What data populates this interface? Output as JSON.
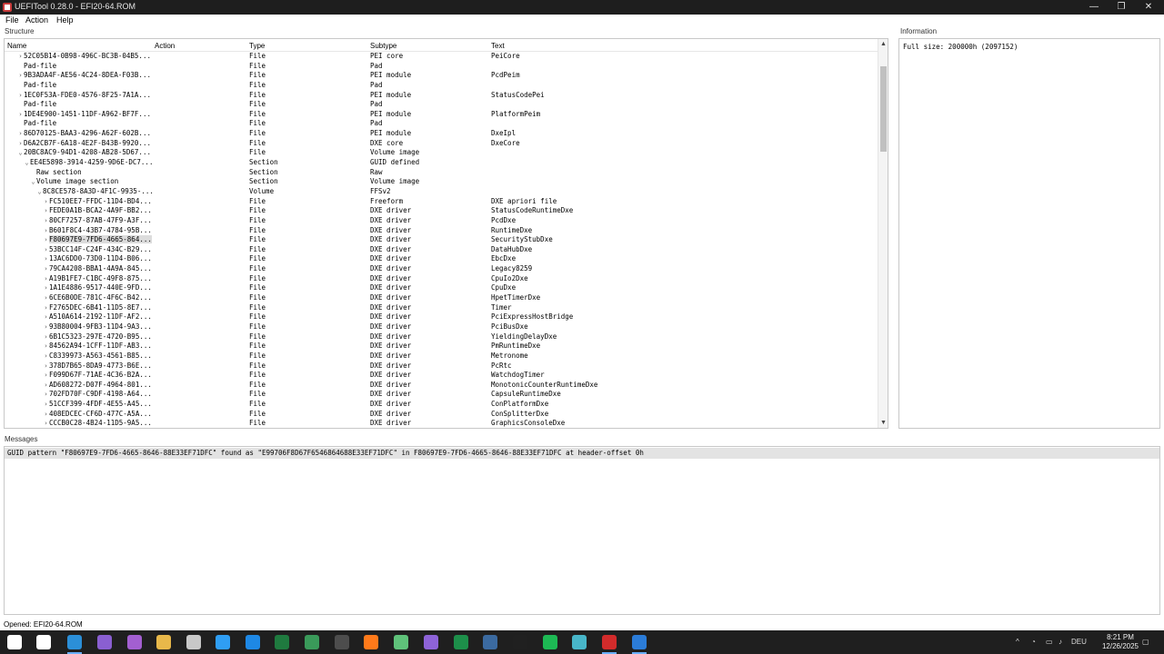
{
  "window": {
    "title": "UEFITool 0.28.0 - EFI20-64.ROM",
    "minimize": "—",
    "restore": "❐",
    "close": "✕"
  },
  "menu": {
    "file": "File",
    "action": "Action",
    "help": "Help"
  },
  "structure": {
    "label": "Structure",
    "columns": {
      "name": "Name",
      "action": "Action",
      "type": "Type",
      "subtype": "Subtype",
      "text": "Text"
    },
    "rows": [
      {
        "name": "52C05B14-0B98-496C-BC3B-04B5...",
        "type": "File",
        "subtype": "PEI core",
        "text": "PeiCore",
        "level": 1,
        "arrow": "›"
      },
      {
        "name": "Pad-file",
        "type": "File",
        "subtype": "Pad",
        "text": "",
        "level": 1,
        "arrow": ""
      },
      {
        "name": "9B3ADA4F-AE56-4C24-8DEA-F03B...",
        "type": "File",
        "subtype": "PEI module",
        "text": "PcdPeim",
        "level": 1,
        "arrow": "›"
      },
      {
        "name": "Pad-file",
        "type": "File",
        "subtype": "Pad",
        "text": "",
        "level": 1,
        "arrow": ""
      },
      {
        "name": "1EC0F53A-FDE0-4576-8F25-7A1A...",
        "type": "File",
        "subtype": "PEI module",
        "text": "StatusCodePei",
        "level": 1,
        "arrow": "›"
      },
      {
        "name": "Pad-file",
        "type": "File",
        "subtype": "Pad",
        "text": "",
        "level": 1,
        "arrow": ""
      },
      {
        "name": "1DE4E900-1451-11DF-A962-BF7F...",
        "type": "File",
        "subtype": "PEI module",
        "text": "PlatformPeim",
        "level": 1,
        "arrow": "›"
      },
      {
        "name": "Pad-file",
        "type": "File",
        "subtype": "Pad",
        "text": "",
        "level": 1,
        "arrow": ""
      },
      {
        "name": "86D70125-BAA3-4296-A62F-602B...",
        "type": "File",
        "subtype": "PEI module",
        "text": "DxeIpl",
        "level": 1,
        "arrow": "›"
      },
      {
        "name": "D6A2CB7F-6A18-4E2F-B43B-9920...",
        "type": "File",
        "subtype": "DXE core",
        "text": "DxeCore",
        "level": 1,
        "arrow": "›"
      },
      {
        "name": "20BC8AC9-94D1-4208-AB28-5D67...",
        "type": "File",
        "subtype": "Volume image",
        "text": "",
        "level": 1,
        "arrow": "⌄"
      },
      {
        "name": "EE4E5898-3914-4259-9D6E-DC7...",
        "type": "Section",
        "subtype": "GUID defined",
        "text": "",
        "level": 2,
        "arrow": "⌄"
      },
      {
        "name": "Raw section",
        "type": "Section",
        "subtype": "Raw",
        "text": "",
        "level": 3,
        "arrow": ""
      },
      {
        "name": "Volume image section",
        "type": "Section",
        "subtype": "Volume image",
        "text": "",
        "level": 3,
        "arrow": "⌄"
      },
      {
        "name": "8C8CE578-8A3D-4F1C-9935-...",
        "type": "Volume",
        "subtype": "FFSv2",
        "text": "",
        "level": 4,
        "arrow": "⌄"
      },
      {
        "name": "FC510EE7-FFDC-11D4-BD4...",
        "type": "File",
        "subtype": "Freeform",
        "text": "DXE apriori file",
        "level": 5,
        "arrow": "›"
      },
      {
        "name": "FEDE0A1B-BCA2-4A9F-BB2...",
        "type": "File",
        "subtype": "DXE driver",
        "text": "StatusCodeRuntimeDxe",
        "level": 5,
        "arrow": "›"
      },
      {
        "name": "80CF7257-87AB-47F9-A3F...",
        "type": "File",
        "subtype": "DXE driver",
        "text": "PcdDxe",
        "level": 5,
        "arrow": "›"
      },
      {
        "name": "B601F8C4-43B7-4784-95B...",
        "type": "File",
        "subtype": "DXE driver",
        "text": "RuntimeDxe",
        "level": 5,
        "arrow": "›"
      },
      {
        "name": "F80697E9-7FD6-4665-864...",
        "type": "File",
        "subtype": "DXE driver",
        "text": "SecurityStubDxe",
        "level": 5,
        "arrow": "›",
        "selected": true
      },
      {
        "name": "53BCC14F-C24F-434C-B29...",
        "type": "File",
        "subtype": "DXE driver",
        "text": "DataHubDxe",
        "level": 5,
        "arrow": "›"
      },
      {
        "name": "13AC6DD0-73D0-11D4-B06...",
        "type": "File",
        "subtype": "DXE driver",
        "text": "EbcDxe",
        "level": 5,
        "arrow": "›"
      },
      {
        "name": "79CA4208-BBA1-4A9A-845...",
        "type": "File",
        "subtype": "DXE driver",
        "text": "Legacy8259",
        "level": 5,
        "arrow": "›"
      },
      {
        "name": "A19B1FE7-C1BC-49F8-875...",
        "type": "File",
        "subtype": "DXE driver",
        "text": "CpuIo2Dxe",
        "level": 5,
        "arrow": "›"
      },
      {
        "name": "1A1E4886-9517-440E-9FD...",
        "type": "File",
        "subtype": "DXE driver",
        "text": "CpuDxe",
        "level": 5,
        "arrow": "›"
      },
      {
        "name": "6CE6B0DE-781C-4F6C-B42...",
        "type": "File",
        "subtype": "DXE driver",
        "text": "HpetTimerDxe",
        "level": 5,
        "arrow": "›"
      },
      {
        "name": "F2765DEC-6B41-11D5-8E7...",
        "type": "File",
        "subtype": "DXE driver",
        "text": "Timer",
        "level": 5,
        "arrow": "›"
      },
      {
        "name": "A510A614-2192-11DF-AF2...",
        "type": "File",
        "subtype": "DXE driver",
        "text": "PciExpressHostBridge",
        "level": 5,
        "arrow": "›"
      },
      {
        "name": "93B80004-9FB3-11D4-9A3...",
        "type": "File",
        "subtype": "DXE driver",
        "text": "PciBusDxe",
        "level": 5,
        "arrow": "›"
      },
      {
        "name": "6B1C5323-297E-4720-B95...",
        "type": "File",
        "subtype": "DXE driver",
        "text": "YieldingDelayDxe",
        "level": 5,
        "arrow": "›"
      },
      {
        "name": "84562A94-1CFF-11DF-AB3...",
        "type": "File",
        "subtype": "DXE driver",
        "text": "PmRuntimeDxe",
        "level": 5,
        "arrow": "›"
      },
      {
        "name": "C8339973-A563-4561-B85...",
        "type": "File",
        "subtype": "DXE driver",
        "text": "Metronome",
        "level": 5,
        "arrow": "›"
      },
      {
        "name": "378D7B65-8DA9-4773-B6E...",
        "type": "File",
        "subtype": "DXE driver",
        "text": "PcRtc",
        "level": 5,
        "arrow": "›"
      },
      {
        "name": "F099D67F-71AE-4C36-B2A...",
        "type": "File",
        "subtype": "DXE driver",
        "text": "WatchdogTimer",
        "level": 5,
        "arrow": "›"
      },
      {
        "name": "AD608272-D07F-4964-801...",
        "type": "File",
        "subtype": "DXE driver",
        "text": "MonotonicCounterRuntimeDxe",
        "level": 5,
        "arrow": "›"
      },
      {
        "name": "702FD70F-C9DF-4198-A64...",
        "type": "File",
        "subtype": "DXE driver",
        "text": "CapsuleRuntimeDxe",
        "level": 5,
        "arrow": "›"
      },
      {
        "name": "51CCF399-4FDF-4E55-A45...",
        "type": "File",
        "subtype": "DXE driver",
        "text": "ConPlatformDxe",
        "level": 5,
        "arrow": "›"
      },
      {
        "name": "408EDCEC-CF6D-477C-A5A...",
        "type": "File",
        "subtype": "DXE driver",
        "text": "ConSplitterDxe",
        "level": 5,
        "arrow": "›"
      },
      {
        "name": "CCCB0C28-4B24-11D5-9A5...",
        "type": "File",
        "subtype": "DXE driver",
        "text": "GraphicsConsoleDxe",
        "level": 5,
        "arrow": "›"
      }
    ]
  },
  "information": {
    "label": "Information",
    "text": "Full size: 200000h (2097152)"
  },
  "messages": {
    "label": "Messages",
    "text": "GUID pattern \"F80697E9-7FD6-4665-8646-88E33EF71DFC\" found as \"E99706F8D67F6546864688E33EF71DFC\" in F80697E9-7FD6-4665-8646-88E33EF71DFC at header-offset 0h"
  },
  "status": {
    "text": "Opened: EFI20-64.ROM"
  },
  "taskbar": {
    "icons": [
      {
        "name": "windows-start-icon",
        "color": "#ffffff"
      },
      {
        "name": "task-view-icon",
        "color": "#ffffff"
      },
      {
        "name": "app-icon-1",
        "color": "#2b8fd8"
      },
      {
        "name": "visual-studio-icon",
        "color": "#8a5fd1"
      },
      {
        "name": "visual-studio-preview-icon",
        "color": "#a35fd1"
      },
      {
        "name": "file-explorer-icon",
        "color": "#e8b84a"
      },
      {
        "name": "network-icon",
        "color": "#c8c8c8"
      },
      {
        "name": "vscode-icon",
        "color": "#2f9ef4"
      },
      {
        "name": "app-icon-2",
        "color": "#1e88e5"
      },
      {
        "name": "excel-like-icon",
        "color": "#1f7a3f"
      },
      {
        "name": "app-icon-3",
        "color": "#3a9a5a"
      },
      {
        "name": "app-icon-4",
        "color": "#4d4d4d"
      },
      {
        "name": "firefox-icon",
        "color": "#ff7a1a"
      },
      {
        "name": "app-icon-5",
        "color": "#5fc27a"
      },
      {
        "name": "app-icon-6",
        "color": "#8e63d8"
      },
      {
        "name": "excel-icon",
        "color": "#1d8f4a"
      },
      {
        "name": "app-icon-7",
        "color": "#3b6aa0"
      },
      {
        "name": "terminal-icon",
        "color": "#202020"
      },
      {
        "name": "spotify-icon",
        "color": "#1db954"
      },
      {
        "name": "app-icon-8",
        "color": "#48b6c9"
      },
      {
        "name": "app-icon-9",
        "color": "#d22b2b"
      },
      {
        "name": "app-icon-10",
        "color": "#2b7cd8"
      }
    ],
    "tray": {
      "chevron": "^",
      "lang": "DEU"
    },
    "clock": {
      "time": "8:21 PM",
      "date": "12/26/2025"
    }
  }
}
